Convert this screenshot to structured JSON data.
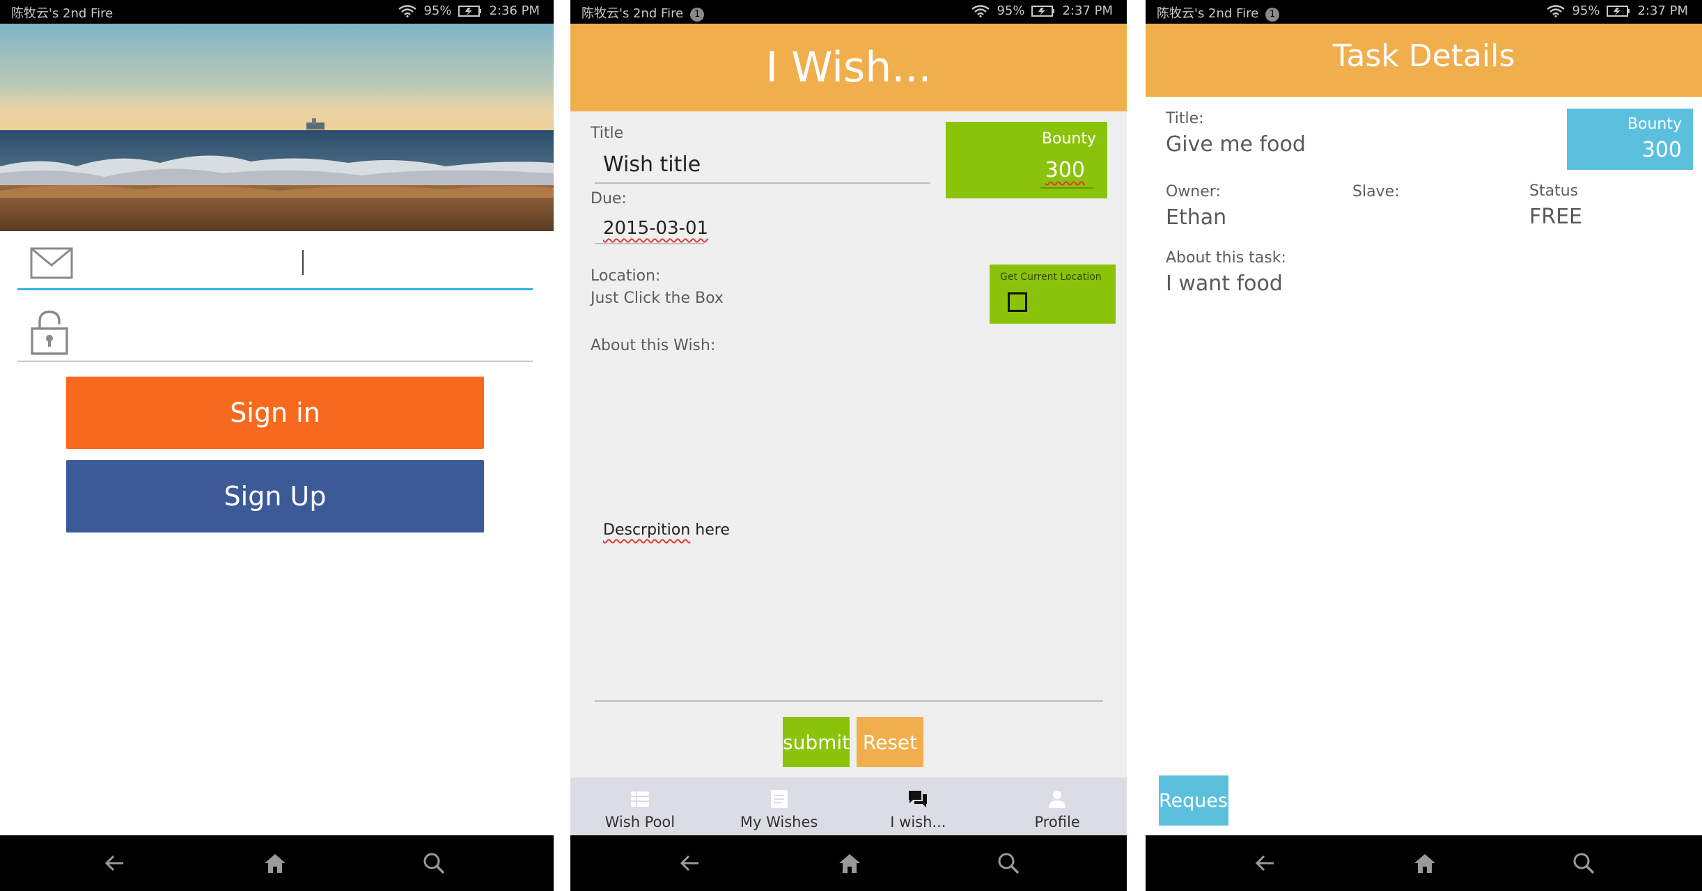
{
  "status_left": {
    "carrier": "陈牧云's 2nd Fire"
  },
  "screen_signin": {
    "status": {
      "carrier": "陈牧云's 2nd Fire",
      "battery": "95%",
      "time": "2:36 PM"
    },
    "email": {
      "value": "",
      "placeholder": ""
    },
    "password": {
      "value": "",
      "placeholder": ""
    },
    "signin_label": "Sign in",
    "signup_label": "Sign Up",
    "colors": {
      "signin": "#f76a1d",
      "signup": "#3c5a98",
      "field_focus": "#33b5e5"
    },
    "icons": [
      "envelope-icon",
      "padlock-icon"
    ]
  },
  "screen_wish": {
    "status": {
      "carrier": "陈牧云's 2nd Fire",
      "notification_count": "1",
      "battery": "95%",
      "time": "2:37 PM"
    },
    "header_title": "I Wish...",
    "title_label": "Title",
    "title_value": "Wish title",
    "due_label": "Due:",
    "due_value": "2015-03-01",
    "bounty_label": "Bounty",
    "bounty_value": "300",
    "location_label": "Location:",
    "location_hint": "Just Click the Box",
    "get_location_label": "Get Current Location",
    "about_label": "About this Wish:",
    "description_word1": "Descrpition",
    "description_word2": " here",
    "submit_label": "submit",
    "reset_label": "Reset",
    "tabs": [
      {
        "label": "Wish Pool",
        "icon": "list-icon"
      },
      {
        "label": "My Wishes",
        "icon": "document-icon"
      },
      {
        "label": "I wish...",
        "icon": "chat-icon"
      },
      {
        "label": "Profile",
        "icon": "person-icon"
      }
    ],
    "colors": {
      "header": "#f0ae4c",
      "accent_green": "#8bc30a",
      "reset": "#f0ae4c"
    }
  },
  "screen_task": {
    "status": {
      "carrier": "陈牧云's 2nd Fire",
      "notification_count": "1",
      "battery": "95%",
      "time": "2:37 PM"
    },
    "header_title": "Task Details",
    "title_label": "Title:",
    "title_value": "Give me food",
    "bounty_label": "Bounty",
    "bounty_value": "300",
    "owner_label": "Owner:",
    "owner_value": "Ethan",
    "slave_label": "Slave:",
    "slave_value": "",
    "status_label": "Status",
    "status_value": "FREE",
    "about_label": "About this task:",
    "about_value": "I want food",
    "request_label": "Request",
    "colors": {
      "bounty": "#5bc0de",
      "request": "#5bc0de"
    }
  }
}
